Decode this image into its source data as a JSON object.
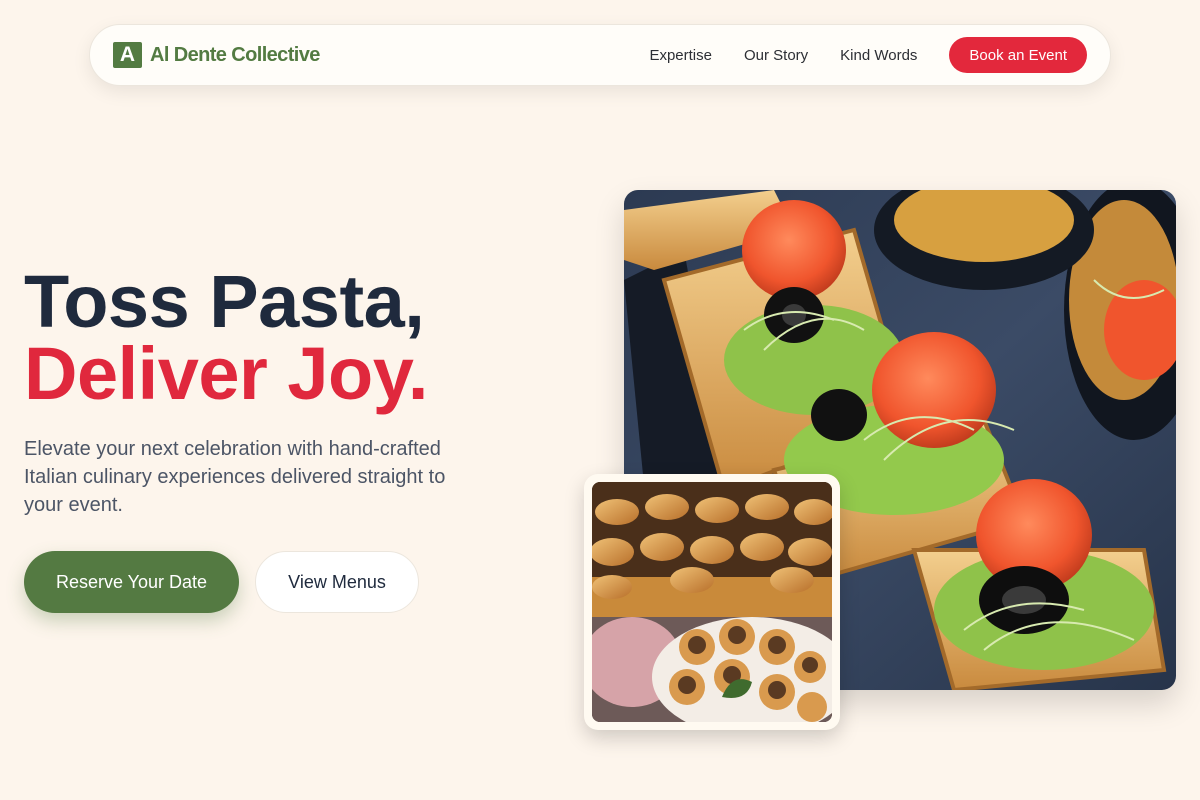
{
  "nav": {
    "logo_mark": "A",
    "brand": "Al Dente Collective",
    "links": [
      "Expertise",
      "Our Story",
      "Kind Words"
    ],
    "cta": "Book an Event"
  },
  "hero": {
    "title_line1": "Toss Pasta,",
    "title_line2": "Deliver Joy.",
    "subtitle": "Elevate your next celebration with hand-crafted Italian culinary experiences delivered straight to your event.",
    "primary_button": "Reserve Your Date",
    "secondary_button": "View Menus"
  },
  "colors": {
    "background": "#fdf5ec",
    "brand_green": "#537b42",
    "accent_red": "#e3283c",
    "heading_navy": "#1f2a3d"
  },
  "images": {
    "main": "salmon-canape-photo",
    "secondary": "pastry-platter-photo"
  }
}
